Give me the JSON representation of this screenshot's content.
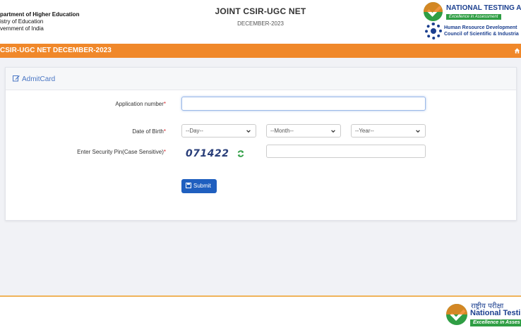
{
  "header": {
    "dept_line1": "partment of Higher Education",
    "dept_line2": "istry of Education",
    "dept_line3": "vernment of India",
    "title": "JOINT CSIR-UGC NET",
    "subtitle": "DECEMBER-2023",
    "nta_name": "NATIONAL TESTING AG",
    "nta_tagline": "Excellence in Assessment",
    "hrd_line1": "Human Resource Development",
    "hrd_line2": "Council of Scientific & Industria"
  },
  "bar": {
    "title": "CSIR-UGC NET DECEMBER-2023",
    "icon": "home-icon",
    "color": "#f0882a"
  },
  "card": {
    "title": "AdmitCard",
    "title_icon": "edit-icon"
  },
  "form": {
    "application_label": "Application number",
    "dob_label": "Date of Birth",
    "pin_label": "Enter Security Pin(Case Sensitive)",
    "required_mark": "*",
    "application_value": "",
    "day_selected": "--Day--",
    "month_selected": "--Month--",
    "year_selected": "--Year--",
    "captcha_text": "071422",
    "pin_value": "",
    "submit_label": "Submit"
  },
  "footer": {
    "hindi_text": "राष्ट्रीय परीक्षा",
    "nta_name": "National Testing",
    "nta_tagline": "Excellence in Asses"
  },
  "colors": {
    "accent": "#f0882a",
    "primary_button": "#1f5fbf",
    "required": "#d9262c",
    "brand_green": "#2f9e44",
    "brand_blue": "#1b3f8f"
  }
}
